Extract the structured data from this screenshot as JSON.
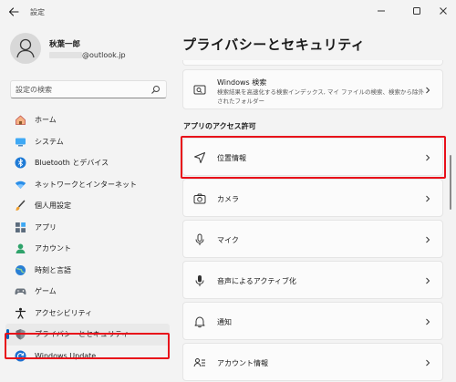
{
  "window": {
    "app_title": "設定"
  },
  "account": {
    "name": "秋葉一郎",
    "email_suffix": "@outlook.jp"
  },
  "search": {
    "placeholder": "設定の検索"
  },
  "sidebar": {
    "items": [
      {
        "label": "ホーム",
        "icon": "home-icon"
      },
      {
        "label": "システム",
        "icon": "system-icon"
      },
      {
        "label": "Bluetooth とデバイス",
        "icon": "bluetooth-icon"
      },
      {
        "label": "ネットワークとインターネット",
        "icon": "wifi-icon"
      },
      {
        "label": "個人用設定",
        "icon": "brush-icon"
      },
      {
        "label": "アプリ",
        "icon": "apps-icon"
      },
      {
        "label": "アカウント",
        "icon": "account-icon"
      },
      {
        "label": "時刻と言語",
        "icon": "globe-icon"
      },
      {
        "label": "ゲーム",
        "icon": "gamepad-icon"
      },
      {
        "label": "アクセシビリティ",
        "icon": "accessibility-icon"
      },
      {
        "label": "プライバシーとセキュリティ",
        "icon": "shield-icon",
        "selected": true
      },
      {
        "label": "Windows Update",
        "icon": "update-icon"
      }
    ]
  },
  "main": {
    "page_title": "プライバシーとセキュリティ",
    "windows_search": {
      "label": "Windows 検索",
      "description": "検索結果を高速化する検索インデックス, マイ ファイルの検索、検索から除外されたフォルダー"
    },
    "section_heading": "アプリのアクセス許可",
    "permissions": [
      {
        "label": "位置情報",
        "icon": "location-icon"
      },
      {
        "label": "カメラ",
        "icon": "camera-icon"
      },
      {
        "label": "マイク",
        "icon": "microphone-icon"
      },
      {
        "label": "音声によるアクティブ化",
        "icon": "voice-icon"
      },
      {
        "label": "通知",
        "icon": "bell-icon"
      },
      {
        "label": "アカウント情報",
        "icon": "account-info-icon"
      }
    ]
  },
  "colors": {
    "accent": "#0067c0",
    "highlight": "#e8101a"
  }
}
